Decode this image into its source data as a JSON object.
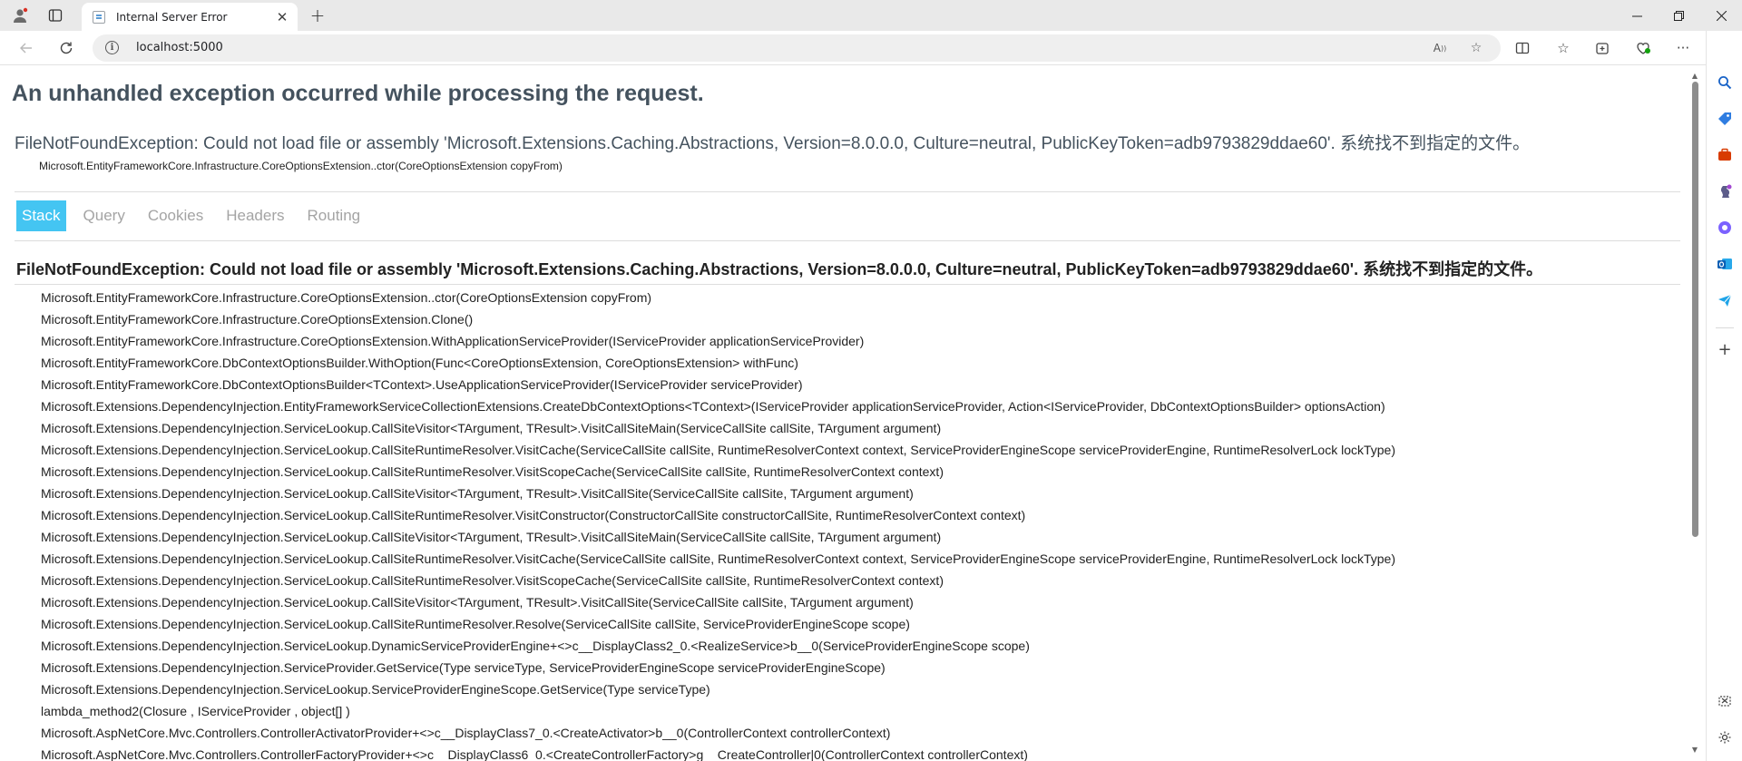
{
  "browser": {
    "tab_title": "Internal Server Error",
    "url": "localhost:5000",
    "accent": "#44c5f2"
  },
  "page": {
    "heading": "An unhandled exception occurred while processing the request.",
    "title_error": "FileNotFoundException: Could not load file or assembly 'Microsoft.Extensions.Caching.Abstractions, Version=8.0.0.0, Culture=neutral, PublicKeyToken=adb9793829ddae60'. 系统找不到指定的文件。",
    "location": "Microsoft.EntityFrameworkCore.Infrastructure.CoreOptionsExtension..ctor(CoreOptionsExtension copyFrom)",
    "tabs": [
      {
        "label": "Stack"
      },
      {
        "label": "Query"
      },
      {
        "label": "Cookies"
      },
      {
        "label": "Headers"
      },
      {
        "label": "Routing"
      }
    ],
    "exception_title": "FileNotFoundException: Could not load file or assembly 'Microsoft.Extensions.Caching.Abstractions, Version=8.0.0.0, Culture=neutral, PublicKeyToken=adb9793829ddae60'. 系统找不到指定的文件。",
    "frames": [
      "Microsoft.EntityFrameworkCore.Infrastructure.CoreOptionsExtension..ctor(CoreOptionsExtension copyFrom)",
      "Microsoft.EntityFrameworkCore.Infrastructure.CoreOptionsExtension.Clone()",
      "Microsoft.EntityFrameworkCore.Infrastructure.CoreOptionsExtension.WithApplicationServiceProvider(IServiceProvider applicationServiceProvider)",
      "Microsoft.EntityFrameworkCore.DbContextOptionsBuilder.WithOption(Func<CoreOptionsExtension, CoreOptionsExtension> withFunc)",
      "Microsoft.EntityFrameworkCore.DbContextOptionsBuilder<TContext>.UseApplicationServiceProvider(IServiceProvider serviceProvider)",
      "Microsoft.Extensions.DependencyInjection.EntityFrameworkServiceCollectionExtensions.CreateDbContextOptions<TContext>(IServiceProvider applicationServiceProvider, Action<IServiceProvider, DbContextOptionsBuilder> optionsAction)",
      "Microsoft.Extensions.DependencyInjection.ServiceLookup.CallSiteVisitor<TArgument, TResult>.VisitCallSiteMain(ServiceCallSite callSite, TArgument argument)",
      "Microsoft.Extensions.DependencyInjection.ServiceLookup.CallSiteRuntimeResolver.VisitCache(ServiceCallSite callSite, RuntimeResolverContext context, ServiceProviderEngineScope serviceProviderEngine, RuntimeResolverLock lockType)",
      "Microsoft.Extensions.DependencyInjection.ServiceLookup.CallSiteRuntimeResolver.VisitScopeCache(ServiceCallSite callSite, RuntimeResolverContext context)",
      "Microsoft.Extensions.DependencyInjection.ServiceLookup.CallSiteVisitor<TArgument, TResult>.VisitCallSite(ServiceCallSite callSite, TArgument argument)",
      "Microsoft.Extensions.DependencyInjection.ServiceLookup.CallSiteRuntimeResolver.VisitConstructor(ConstructorCallSite constructorCallSite, RuntimeResolverContext context)",
      "Microsoft.Extensions.DependencyInjection.ServiceLookup.CallSiteVisitor<TArgument, TResult>.VisitCallSiteMain(ServiceCallSite callSite, TArgument argument)",
      "Microsoft.Extensions.DependencyInjection.ServiceLookup.CallSiteRuntimeResolver.VisitCache(ServiceCallSite callSite, RuntimeResolverContext context, ServiceProviderEngineScope serviceProviderEngine, RuntimeResolverLock lockType)",
      "Microsoft.Extensions.DependencyInjection.ServiceLookup.CallSiteRuntimeResolver.VisitScopeCache(ServiceCallSite callSite, RuntimeResolverContext context)",
      "Microsoft.Extensions.DependencyInjection.ServiceLookup.CallSiteVisitor<TArgument, TResult>.VisitCallSite(ServiceCallSite callSite, TArgument argument)",
      "Microsoft.Extensions.DependencyInjection.ServiceLookup.CallSiteRuntimeResolver.Resolve(ServiceCallSite callSite, ServiceProviderEngineScope scope)",
      "Microsoft.Extensions.DependencyInjection.ServiceLookup.DynamicServiceProviderEngine+<>c__DisplayClass2_0.<RealizeService>b__0(ServiceProviderEngineScope scope)",
      "Microsoft.Extensions.DependencyInjection.ServiceProvider.GetService(Type serviceType, ServiceProviderEngineScope serviceProviderEngineScope)",
      "Microsoft.Extensions.DependencyInjection.ServiceLookup.ServiceProviderEngineScope.GetService(Type serviceType)",
      "lambda_method2(Closure , IServiceProvider , object[] )",
      "Microsoft.AspNetCore.Mvc.Controllers.ControllerActivatorProvider+<>c__DisplayClass7_0.<CreateActivator>b__0(ControllerContext controllerContext)",
      "Microsoft.AspNetCore.Mvc.Controllers.ControllerFactoryProvider+<>c__DisplayClass6_0.<CreateControllerFactory>g__CreateController|0(ControllerContext controllerContext)"
    ]
  }
}
